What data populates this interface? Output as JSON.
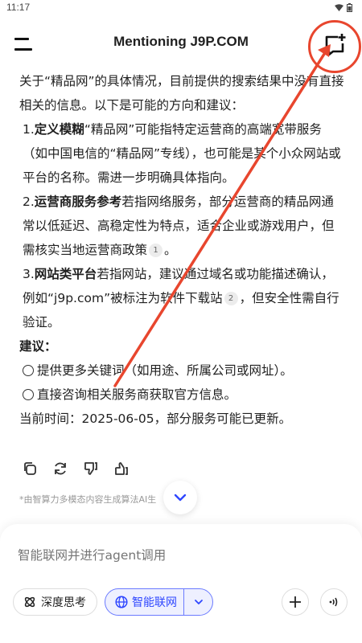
{
  "status": {
    "time": "11:17"
  },
  "header": {
    "title": "Mentioning J9P.COM"
  },
  "answer": {
    "intro": "关于“精品网”的具体情况，目前提供的搜索结果中没有直接相关的信息。以下是可能的方向和建议：",
    "items": [
      {
        "num": "1.",
        "bold": "定义模糊",
        "text": "“精品网”可能指特定运营商的高端宽带服务（如中国电信的“精品网”专线），也可能是某个小众网站或平台的名称。需进一步明确具体指向。",
        "after": ""
      },
      {
        "num": "2.",
        "bold": "运营商服务参考",
        "text": "若指网络服务，部分运营商的精品网通常以低延迟、高稳定性为特点，适合企业或游戏用户，但需核实当地运营商政策",
        "cite": "1",
        "after": "。"
      },
      {
        "num": "3.",
        "bold": "网站类平台",
        "text": "若指网站，建议通过域名或功能描述确认，例如“j9p.com”被标注为软件下载站",
        "cite": "2",
        "after": "，但安全性需自行验证。"
      }
    ],
    "suggest_label": "建议：",
    "bullets": [
      "提供更多关键词（如用途、所属公司或网址）。",
      "直接咨询相关服务商获取官方信息。"
    ],
    "footer": "当前时间：2025-06-05，部分服务可能已更新。"
  },
  "actions": {
    "icons": [
      "copy-icon",
      "refresh-icon",
      "thumbs-down-icon",
      "thumbs-up-icon"
    ],
    "disclaimer": "*由智算力多模态内容生成算法AI生"
  },
  "composer": {
    "placeholder": "智能联网并进行agent调用",
    "deep_think_label": "深度思考",
    "web_search_label": "智能联网"
  },
  "colors": {
    "accent": "#2f47ff",
    "annotation": "#e8462e"
  }
}
